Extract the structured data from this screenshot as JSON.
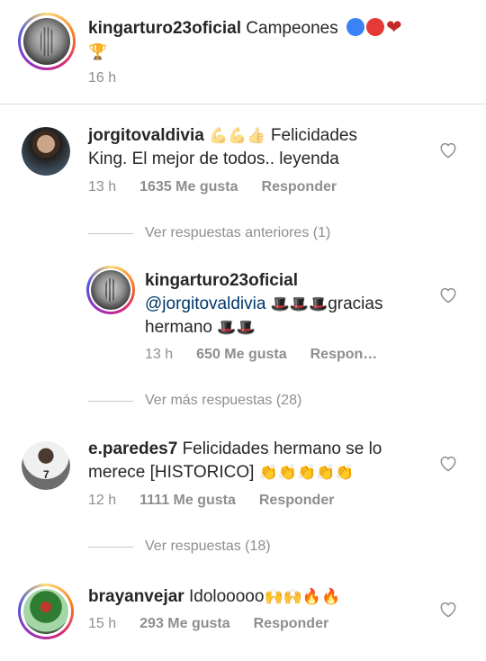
{
  "caption": {
    "username": "kingarturo23oficial",
    "text": "Campeones",
    "emojis": "🔵🔴❤",
    "trophy": "🏆",
    "time": "16 h"
  },
  "comments": [
    {
      "username": "jorgitovaldivia",
      "emojis": "💪💪👍",
      "text_line1": "Felicidades",
      "text_line2": "King. El mejor de todos.. leyenda",
      "time": "13 h",
      "likes": "1635 Me gusta",
      "reply": "Responder",
      "view_replies": "Ver respuestas anteriores (1)"
    },
    {
      "username": "kingarturo23oficial",
      "mention": "@jorgitovaldivia",
      "hats": "🎩🎩🎩",
      "text": "gracias",
      "text_line2": "hermano",
      "hats2": "🎩🎩",
      "time": "13 h",
      "likes": "650 Me gusta",
      "reply": "Respon…",
      "view_more": "Ver más respuestas (28)"
    },
    {
      "username": "e.paredes7",
      "text_line1": "Felicidades hermano se lo",
      "text_line2": "merece [HISTORICO]",
      "emojis": "👏👏👏👏👏",
      "time": "12 h",
      "likes": "1111 Me gusta",
      "reply": "Responder",
      "view_replies": "Ver respuestas (18)"
    },
    {
      "username": "brayanvejar",
      "text": "Idolooooo",
      "emojis": "🙌🙌🔥🔥",
      "time": "15 h",
      "likes": "293 Me gusta",
      "reply": "Responder"
    }
  ],
  "colors": {
    "blue_dot": "#3b82f6",
    "red_dot": "#e53935",
    "heart_red": "#c62828",
    "mention": "#00376b",
    "meta_gray": "#8e8e8e"
  }
}
